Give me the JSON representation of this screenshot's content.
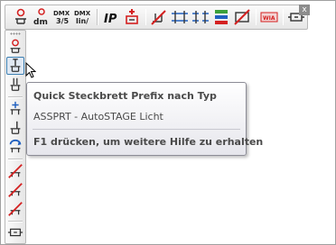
{
  "toolbar": {
    "buttons": [
      {
        "icon": "plug-q-icon"
      },
      {
        "icon": "dmx-dim-icon",
        "text": "dm"
      },
      {
        "icon": "dmx-35-icon",
        "text_top": "DMX",
        "text_bottom": "3/5"
      },
      {
        "icon": "dmx-linx-icon",
        "text_top": "DMX",
        "text_bottom": "lin/"
      },
      {
        "icon": "ip-address-icon",
        "text": "IP"
      },
      {
        "icon": "add-plug-icon"
      },
      {
        "icon": "remove-link-icon"
      },
      {
        "icon": "horizontal-connect-icon"
      },
      {
        "icon": "horizontal-split-icon"
      },
      {
        "icon": "color-sort-icon"
      },
      {
        "icon": "delete-cross-icon"
      },
      {
        "icon": "wia-label-icon",
        "text": "WIA"
      },
      {
        "icon": "plug-box-icon"
      }
    ],
    "close_label": "x"
  },
  "vtoolbar": {
    "buttons": [
      {
        "icon": "plug-q-icon"
      },
      {
        "icon": "plug-prefix-type-icon",
        "active": true
      },
      {
        "icon": "plug-down-icon"
      },
      {
        "icon": "plug-plus-icon"
      },
      {
        "icon": "plug-left-icon"
      },
      {
        "icon": "plug-refresh-icon"
      },
      {
        "icon": "plug-strike-icon"
      },
      {
        "icon": "plug-strike-2-icon"
      },
      {
        "icon": "plug-strike-3-icon"
      },
      {
        "icon": "plug-box-icon"
      }
    ]
  },
  "tooltip": {
    "title": "Quick Steckbrett Prefix nach Typ",
    "description": "ASSPRT - AutoSTAGE Licht",
    "help": "F1 drücken, um weitere Hilfe zu erhalten"
  },
  "colors": {
    "accent_red": "#d42020",
    "accent_blue": "#2060c0",
    "active_border": "#3c7fb1"
  }
}
